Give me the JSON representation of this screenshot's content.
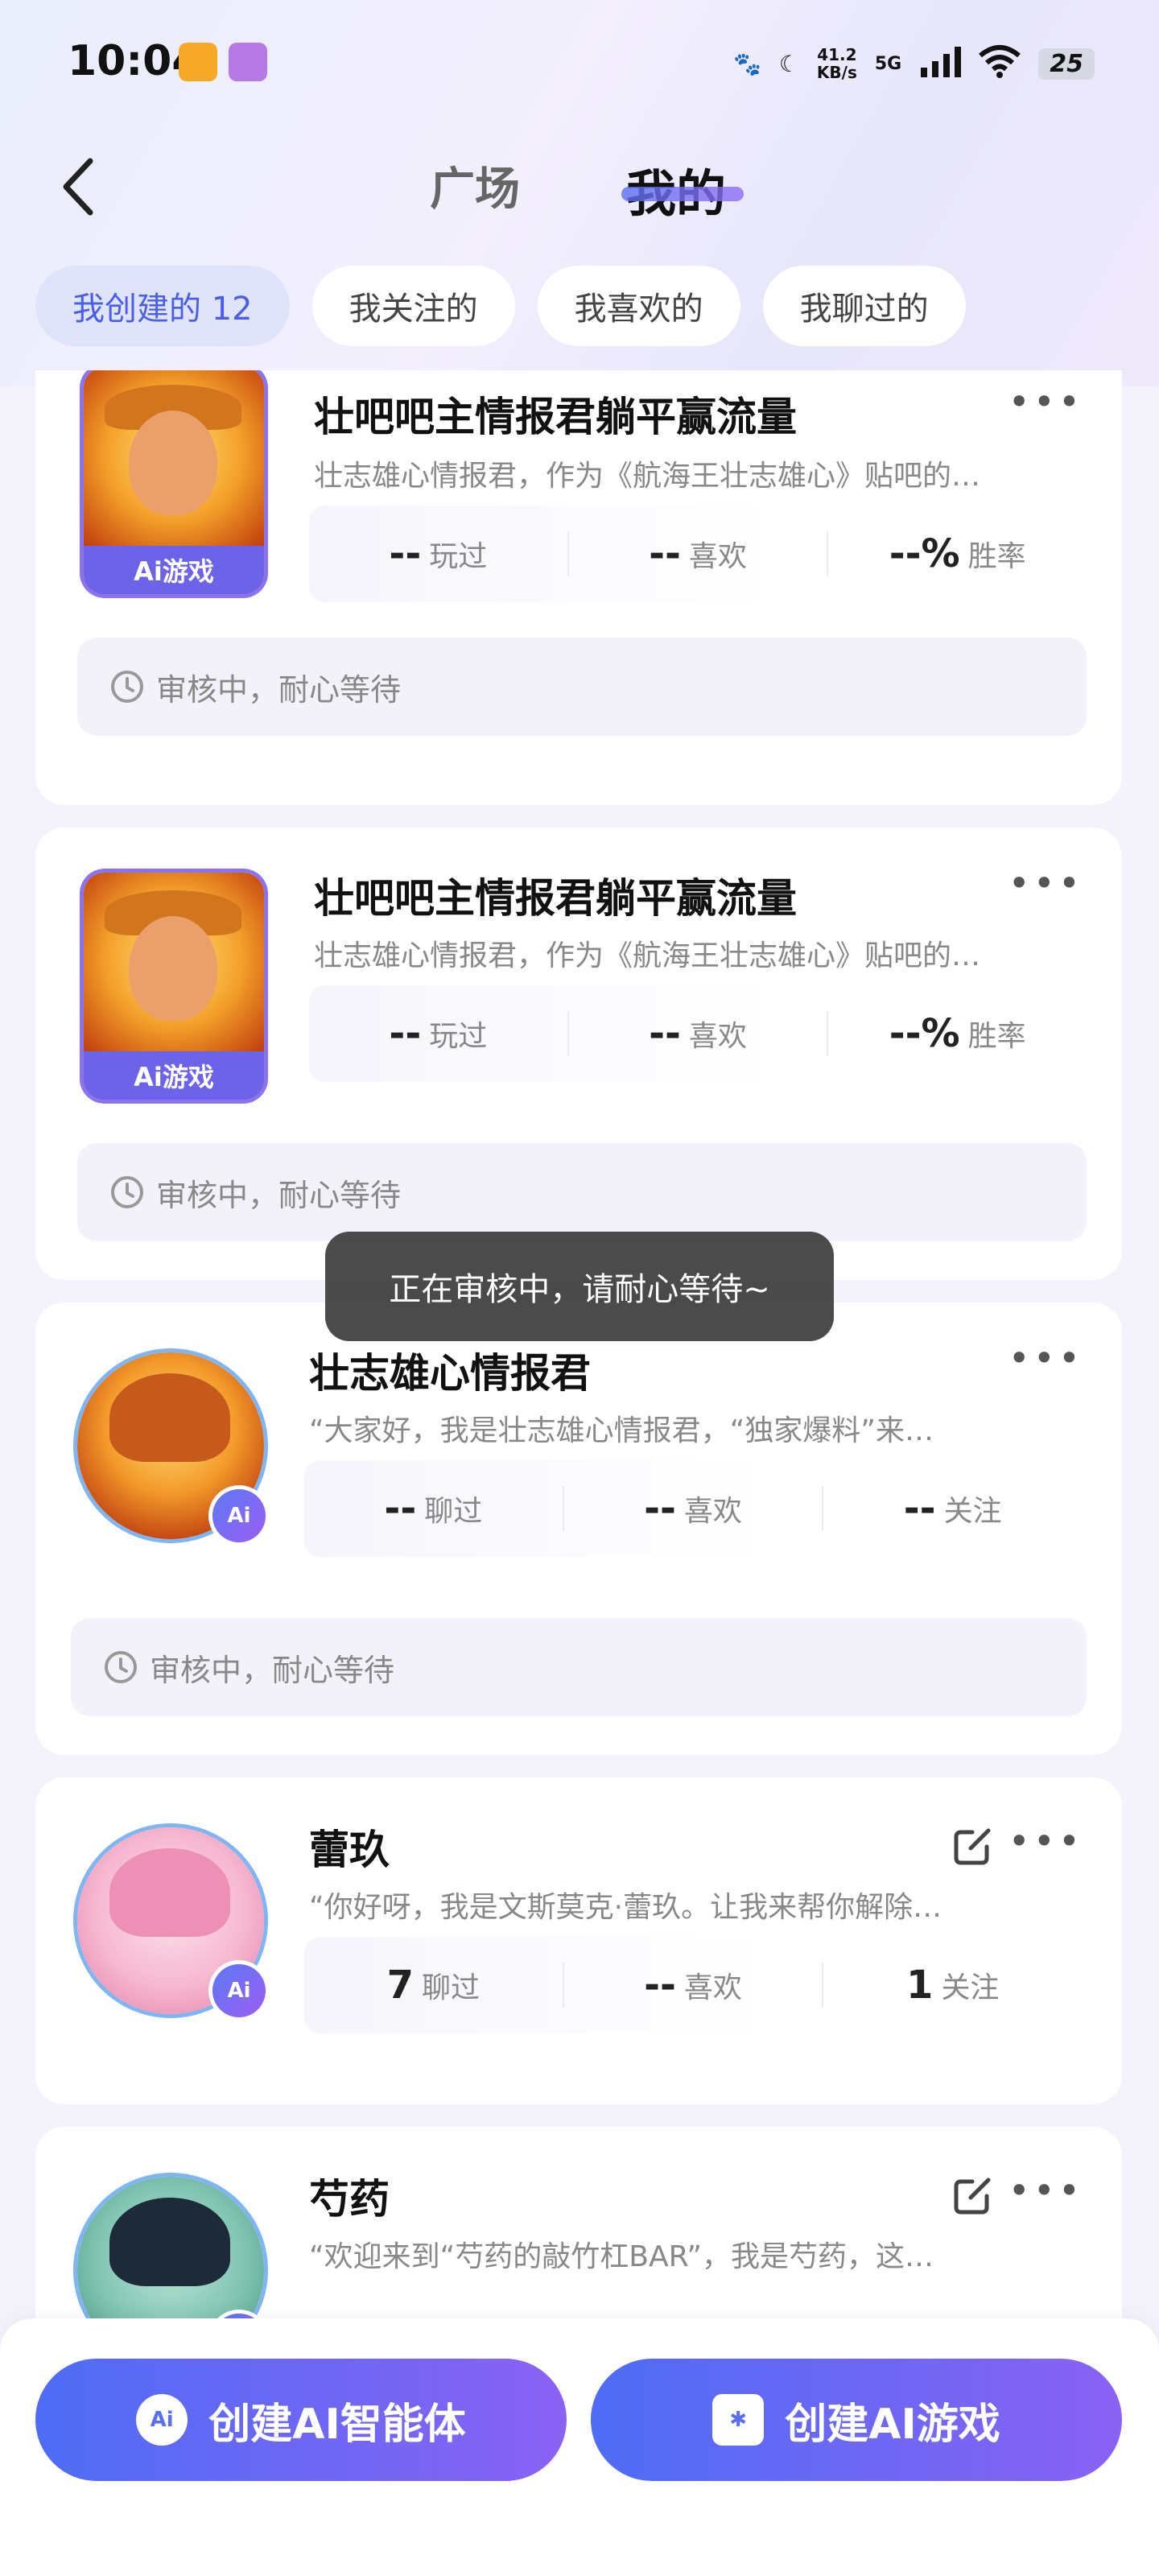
{
  "status_bar": {
    "time": "10:04",
    "net_speed_value": "41.2",
    "net_speed_unit": "KB/s",
    "network": "5G",
    "battery": "25"
  },
  "nav": {
    "tabs": [
      {
        "label": "广场",
        "active": false
      },
      {
        "label": "我的",
        "active": true
      }
    ]
  },
  "filters": [
    {
      "label": "我创建的 12",
      "active": true
    },
    {
      "label": "我关注的",
      "active": false
    },
    {
      "label": "我喜欢的",
      "active": false
    },
    {
      "label": "我聊过的",
      "active": false
    }
  ],
  "cards": [
    {
      "type": "game",
      "title": "壮吧吧主情报君躺平赢流量",
      "description": "壮志雄心情报君，作为《航海王壮志雄心》贴吧的…",
      "cover_label": "Ai游戏",
      "stats": [
        {
          "value": "--",
          "label": "玩过"
        },
        {
          "value": "--",
          "label": "喜欢"
        },
        {
          "value": "--%",
          "label": "胜率"
        }
      ],
      "review_text": "审核中，耐心等待"
    },
    {
      "type": "game",
      "title": "壮吧吧主情报君躺平赢流量",
      "description": "壮志雄心情报君，作为《航海王壮志雄心》贴吧的…",
      "cover_label": "Ai游戏",
      "stats": [
        {
          "value": "--",
          "label": "玩过"
        },
        {
          "value": "--",
          "label": "喜欢"
        },
        {
          "value": "--%",
          "label": "胜率"
        }
      ],
      "review_text": "审核中，耐心等待"
    },
    {
      "type": "agent",
      "title": "壮志雄心情报君",
      "description": "“大家好，我是壮志雄心情报君，“独家爆料”来…",
      "badge": "Ai",
      "stats": [
        {
          "value": "--",
          "label": "聊过"
        },
        {
          "value": "--",
          "label": "喜欢"
        },
        {
          "value": "--",
          "label": "关注"
        }
      ],
      "review_text": "审核中，耐心等待"
    },
    {
      "type": "agent",
      "title": "蕾玖",
      "description": "“你好呀，我是文斯莫克·蕾玖。让我来帮你解除…",
      "badge": "Ai",
      "stats": [
        {
          "value": "7",
          "label": "聊过"
        },
        {
          "value": "--",
          "label": "喜欢"
        },
        {
          "value": "1",
          "label": "关注"
        }
      ]
    },
    {
      "type": "agent",
      "title": "芍药",
      "description": "“欢迎来到“芍药的敲竹杠BAR”，我是芍药，这…",
      "badge": "Ai"
    }
  ],
  "toast": "正在审核中，请耐心等待~",
  "actions": {
    "create_agent": "创建AI智能体",
    "create_agent_icon": "Ai",
    "create_game": "创建AI游戏"
  },
  "colors": {
    "accent": "#5a6ff0",
    "accent_end": "#8a62f4",
    "chip_active_bg": "#dfe4fb",
    "page_bg": "#f4f2fa"
  }
}
